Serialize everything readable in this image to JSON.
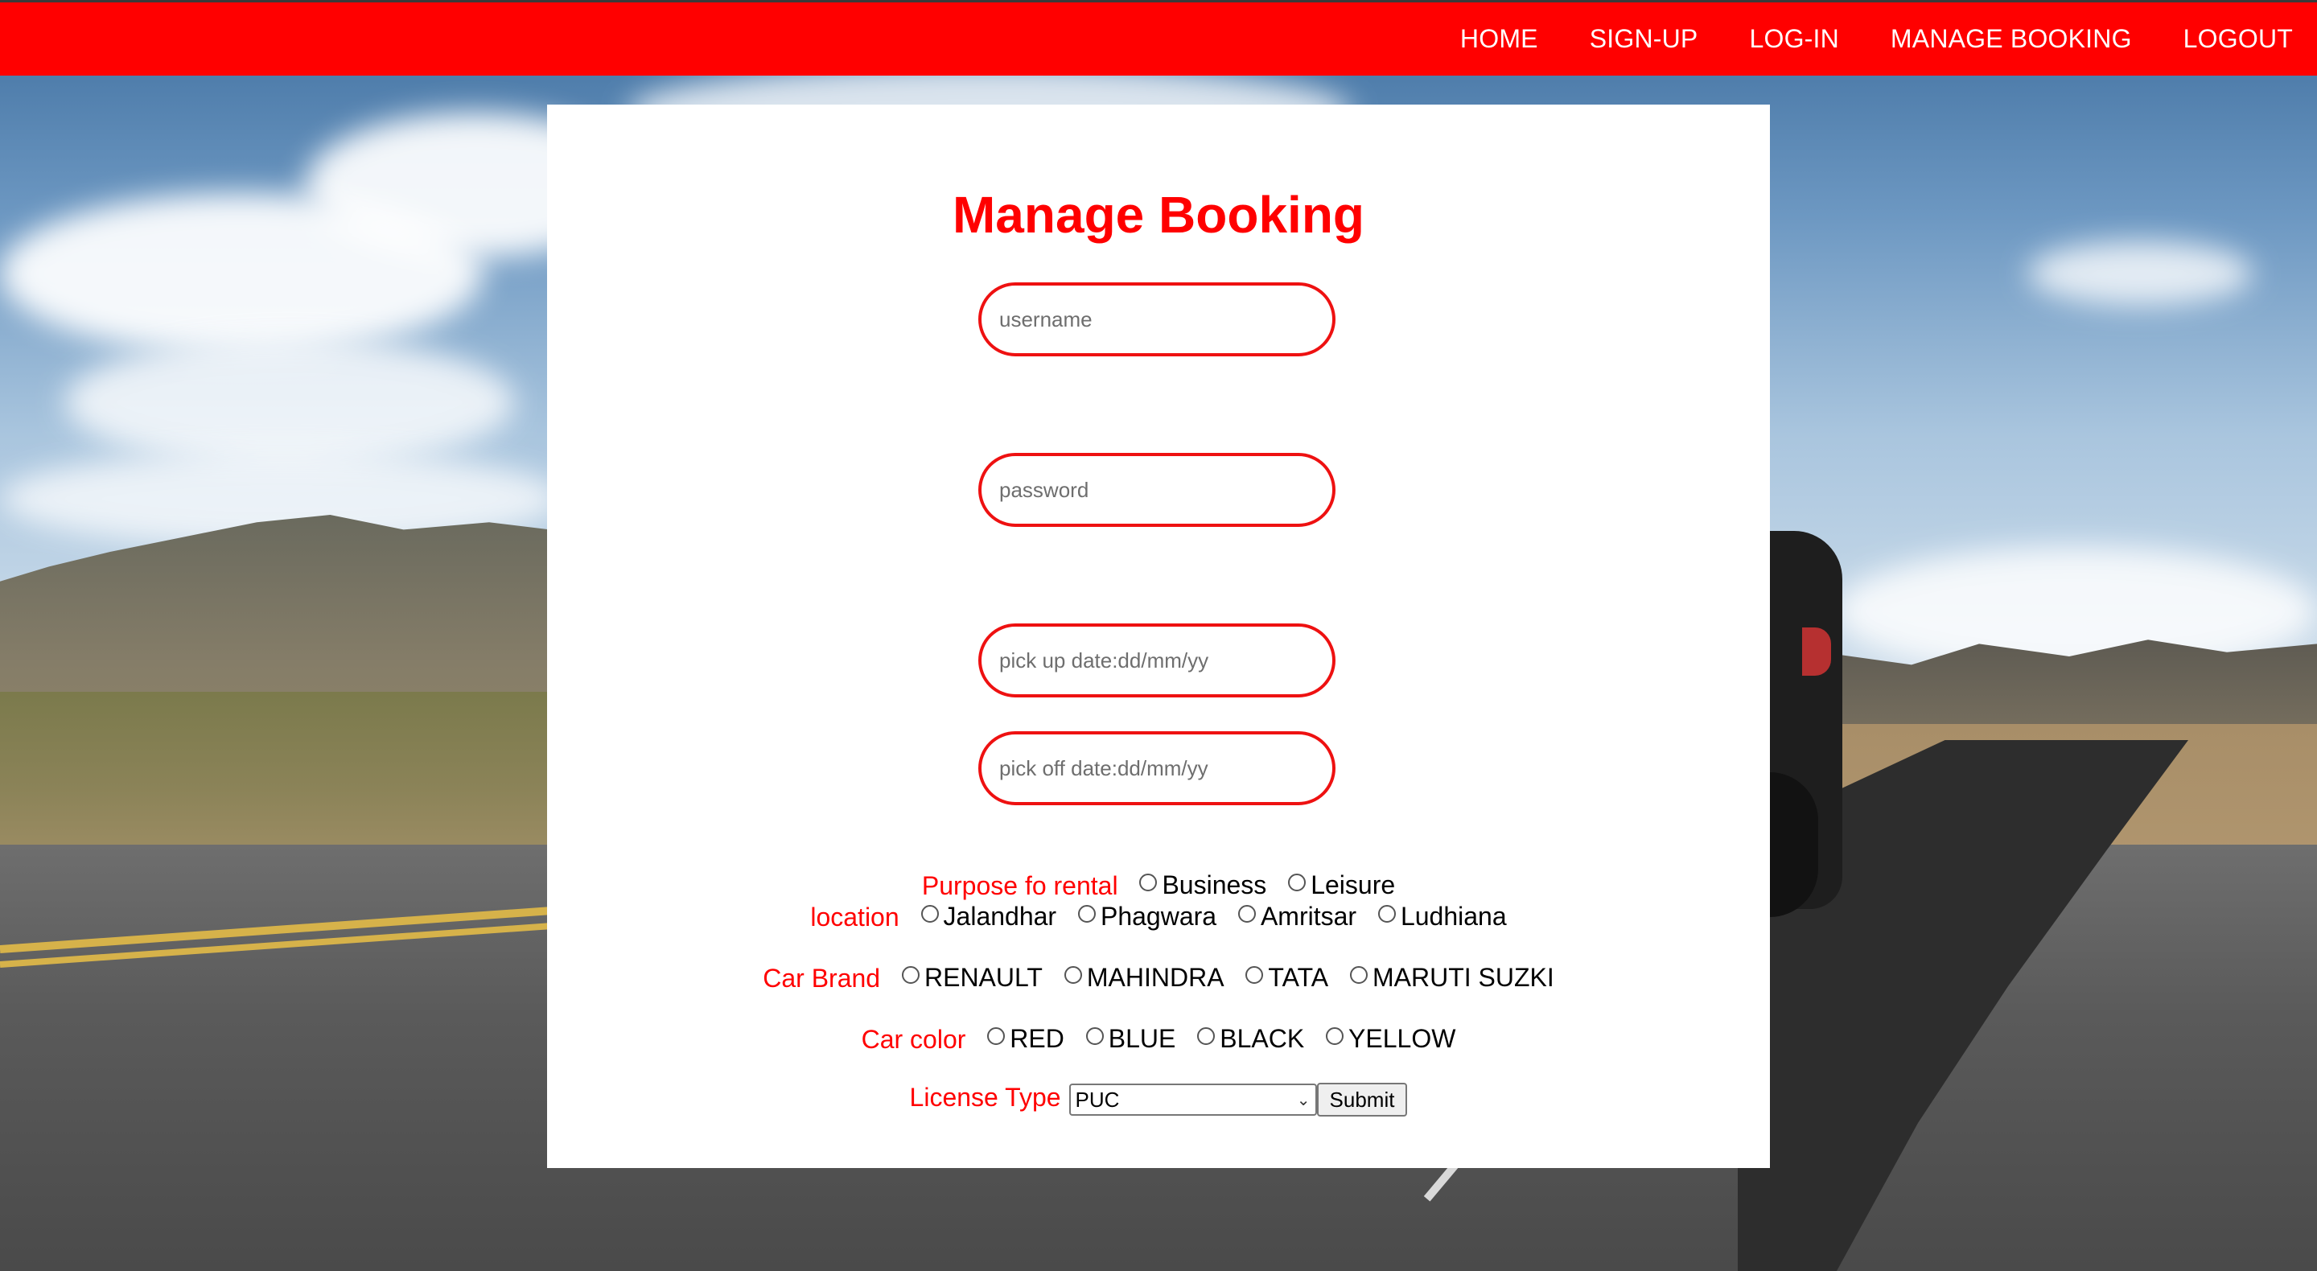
{
  "nav": {
    "items": [
      "HOME",
      "SIGN-UP",
      "LOG-IN",
      "MANAGE BOOKING",
      "LOGOUT"
    ]
  },
  "form": {
    "title": "Manage Booking",
    "username_placeholder": "username",
    "password_placeholder": "password",
    "pickup_placeholder": "pick up date:dd/mm/yy",
    "pickoff_placeholder": "pick off date:dd/mm/yy",
    "purpose": {
      "label": "Purpose fo rental",
      "options": [
        "Business",
        "Leisure"
      ]
    },
    "location": {
      "label": "location",
      "options": [
        "Jalandhar",
        "Phagwara",
        "Amritsar",
        "Ludhiana"
      ]
    },
    "brand": {
      "label": "Car Brand",
      "options": [
        "RENAULT",
        "MAHINDRA",
        "TATA",
        "MARUTI SUZKI"
      ]
    },
    "color": {
      "label": "Car color",
      "options": [
        "RED",
        "BLUE",
        "BLACK",
        "YELLOW"
      ]
    },
    "license": {
      "label": "License Type",
      "selected": "PUC"
    },
    "submit_label": "Submit"
  },
  "colors": {
    "accent": "#ff0000",
    "nav_bg": "#ff0000",
    "card_bg": "#ffffff"
  }
}
